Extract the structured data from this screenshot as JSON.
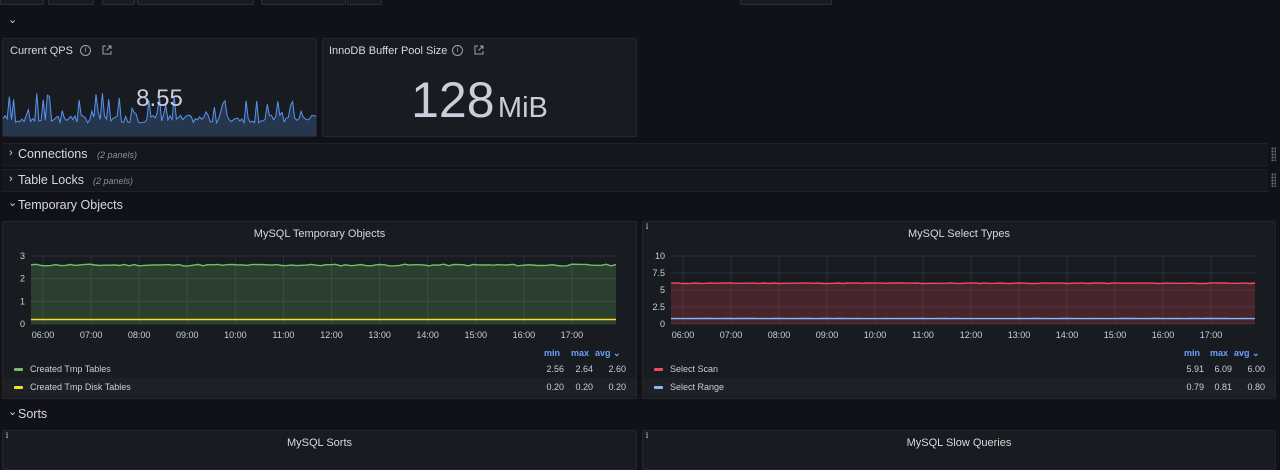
{
  "toolbar": {
    "labels": []
  },
  "collapse_chevron": "⌄",
  "stats": {
    "qps": {
      "title": "Current QPS",
      "value": "8.55",
      "color": "#5794f2"
    },
    "innodb": {
      "title": "InnoDB Buffer Pool Size",
      "value": "128",
      "unit": "MiB"
    }
  },
  "rows": {
    "connections": {
      "title": "Connections",
      "count": "(2 panels)",
      "collapsed": true
    },
    "table_locks": {
      "title": "Table Locks",
      "count": "(2 panels)",
      "collapsed": true
    },
    "temporary_objects": {
      "title": "Temporary Objects",
      "collapsed": false
    },
    "sorts": {
      "title": "Sorts",
      "collapsed": false
    }
  },
  "legend_headers": {
    "min": "min",
    "max": "max",
    "avg": "avg"
  },
  "chart_data": [
    {
      "id": "tmp",
      "type": "line",
      "title": "MySQL Temporary Objects",
      "x_ticks": [
        "06:00",
        "07:00",
        "08:00",
        "09:00",
        "10:00",
        "11:00",
        "12:00",
        "13:00",
        "14:00",
        "15:00",
        "16:00",
        "17:00"
      ],
      "x_range": [
        "05:45",
        "17:55"
      ],
      "y_ticks": [
        0,
        1,
        2,
        3
      ],
      "ylim": [
        0,
        3
      ],
      "grid": true,
      "series": [
        {
          "name": "Created Tmp Tables",
          "color": "#73bf69",
          "fill": true,
          "level": 2.6,
          "jitter": 0.04,
          "min": "2.56",
          "max": "2.64",
          "avg": "2.60"
        },
        {
          "name": "Created Tmp Disk Tables",
          "color": "#fade2a",
          "fill": false,
          "level": 0.2,
          "jitter": 0.0,
          "min": "0.20",
          "max": "0.20",
          "avg": "0.20"
        }
      ]
    },
    {
      "id": "sel",
      "type": "line",
      "title": "MySQL Select Types",
      "x_ticks": [
        "06:00",
        "07:00",
        "08:00",
        "09:00",
        "10:00",
        "11:00",
        "12:00",
        "13:00",
        "14:00",
        "15:00",
        "16:00",
        "17:00"
      ],
      "x_range": [
        "05:45",
        "17:55"
      ],
      "y_ticks": [
        0,
        2.5,
        5,
        7.5,
        10
      ],
      "ylim": [
        0,
        10
      ],
      "grid": true,
      "series": [
        {
          "name": "Select Scan",
          "color": "#f2495c",
          "fill": true,
          "level": 6.0,
          "jitter": 0.05,
          "min": "5.91",
          "max": "6.09",
          "avg": "6.00"
        },
        {
          "name": "Select Range",
          "color": "#8ab8ff",
          "fill": false,
          "level": 0.8,
          "jitter": 0.01,
          "min": "0.79",
          "max": "0.81",
          "avg": "0.80"
        }
      ]
    }
  ],
  "bottom_panels": {
    "sorts": {
      "title": "MySQL Sorts"
    },
    "slow": {
      "title": "MySQL Slow Queries"
    }
  }
}
